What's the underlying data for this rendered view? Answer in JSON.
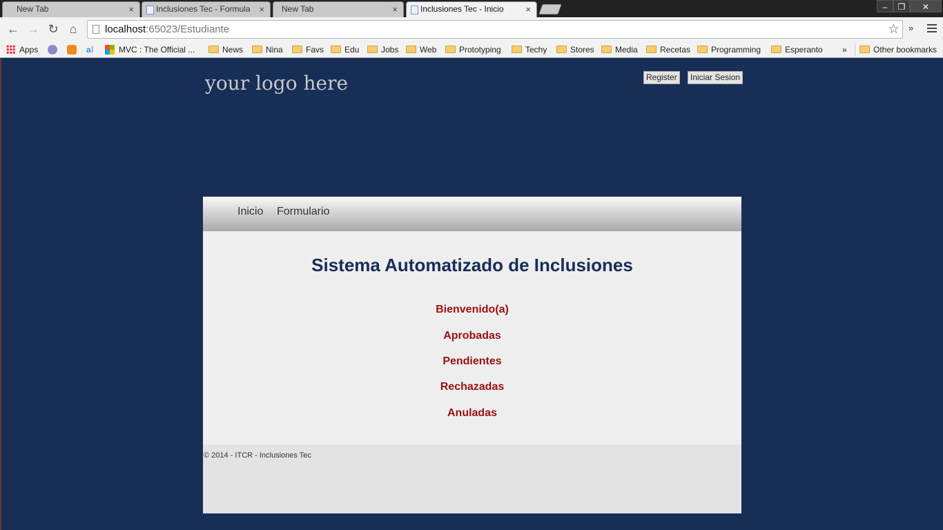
{
  "browser": {
    "tabs": [
      {
        "title": "New Tab",
        "active": false
      },
      {
        "title": "Inclusiones Tec - Formula",
        "active": false
      },
      {
        "title": "New Tab",
        "active": false
      },
      {
        "title": "Inclusiones Tec - Inicio",
        "active": true
      }
    ],
    "address": {
      "host": "localhost",
      "rest": ":65023/Estudiante"
    },
    "bookmarks": {
      "apps_label": "Apps",
      "mvc_label": "MVC : The Official ...",
      "folders": [
        "News",
        "Nina",
        "Favs",
        "Edu",
        "Jobs",
        "Web",
        "Prototyping",
        "Techy",
        "Stores",
        "Media",
        "Recetas",
        "Programming",
        "Esperanto"
      ],
      "overflow": "»",
      "other": "Other bookmarks"
    }
  },
  "header": {
    "logo": "your logo here",
    "register_label": "Register",
    "login_label": "Iniciar Sesion"
  },
  "nav": {
    "items": [
      "Inicio",
      "Formulario"
    ]
  },
  "main": {
    "title": "Sistema Automatizado de Inclusiones",
    "links": [
      "Bienvenido(a)",
      "Aprobadas",
      "Pendientes",
      "Rechazadas",
      "Anuladas"
    ]
  },
  "footer": {
    "text": "© 2014 - ITCR - Inclusiones Tec"
  },
  "colors": {
    "page_background": "#172e57",
    "title": "#172e57",
    "links": "#9b1010",
    "content_background": "#eeeeee"
  }
}
